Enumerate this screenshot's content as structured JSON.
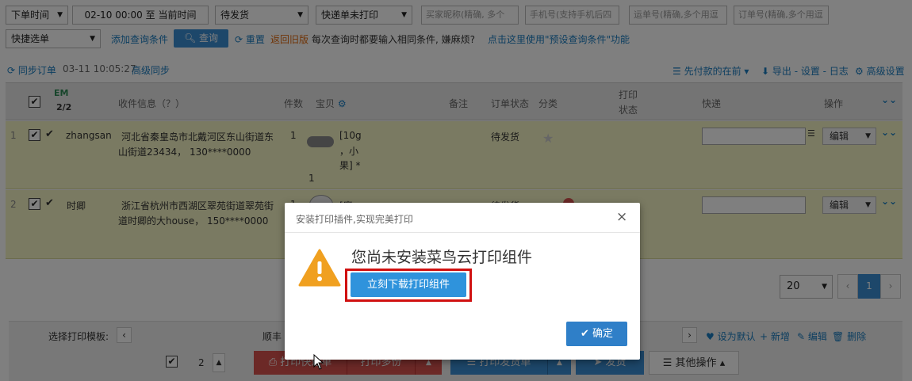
{
  "filters": {
    "order_time_select": "下单时间",
    "time_range": "02-10 00:00 至 当前时间",
    "status_select": "待发货",
    "express_print_select": "快递单未打印",
    "buyer_placeholder": "买家昵称(精确, 多个",
    "phone_placeholder": "手机号(支持手机后四",
    "waybill_placeholder": "运单号(精确,多个用逗",
    "order_no_placeholder": "订单号(精确,多个用逗",
    "quick_select": "快捷选单",
    "add_condition": "添加查询条件",
    "search_label": "查询",
    "reset_label": "重置",
    "old_version_label": "返回旧版",
    "hint_text": "每次查询时都要输入相同条件, 嫌麻烦?",
    "preset_link": "点击这里使用\"预设查询条件\"功能"
  },
  "toolbar": {
    "sync_label": "同步订单",
    "sync_time": "03-11 10:05:27",
    "advanced_sync": "高级同步",
    "sort_label": "先付款的在前",
    "export_label": "导出 - 设置 - 日志",
    "advanced_settings": "高级设置"
  },
  "table": {
    "header": {
      "em": "EM",
      "count": "2/2",
      "receiver": "收件信息（？）",
      "qty": "件数",
      "item": "宝贝",
      "remark": "备注",
      "status": "订单状态",
      "category": "分类",
      "print_status_1": "打印",
      "print_status_2": "状态",
      "express": "快递",
      "operation": "操作"
    },
    "rows": [
      {
        "index": "1",
        "buyer": "zhangsan",
        "address_1": "河北省秦皇岛市北戴河区东山街道东",
        "address_2": "山街道23434， 130****0000",
        "qty": "1",
        "item_1": "[10g",
        "item_2": "，小",
        "item_3": "果] *",
        "item_qty": "1",
        "status": "待发货",
        "edit": "编辑"
      },
      {
        "index": "2",
        "buyer": "时卿",
        "address_1": "浙江省杭州市西湖区翠苑街道翠苑街",
        "address_2": "道时卿的大house， 150****0000",
        "qty": "1",
        "item_1": "[魔",
        "status": "待发货",
        "edit": "编辑"
      }
    ]
  },
  "pagination": {
    "page_size": "20",
    "prev": "‹",
    "current": "1",
    "next": "›"
  },
  "bottom": {
    "template_label": "选择打印模板:",
    "template_name": "顺丰",
    "set_default": "设为默认",
    "add_new": "新增",
    "edit": "编辑",
    "delete": "删除",
    "count": "2",
    "print_express": "打印快递单",
    "print_multi": "打印多份",
    "print_invoice": "打印发货单",
    "ship": "发货",
    "other_ops": "其他操作"
  },
  "modal": {
    "title": "安装打印插件,实现完美打印",
    "message": "您尚未安装菜鸟云打印组件",
    "download_button": "立刻下载打印组件",
    "confirm_button": "确定",
    "close": "×"
  },
  "colors": {
    "accent": "#3b8ed4",
    "row_bg": "#f5f5c4",
    "print_red": "#d9534f",
    "warning": "#f0a020",
    "highlight": "#d01010"
  }
}
